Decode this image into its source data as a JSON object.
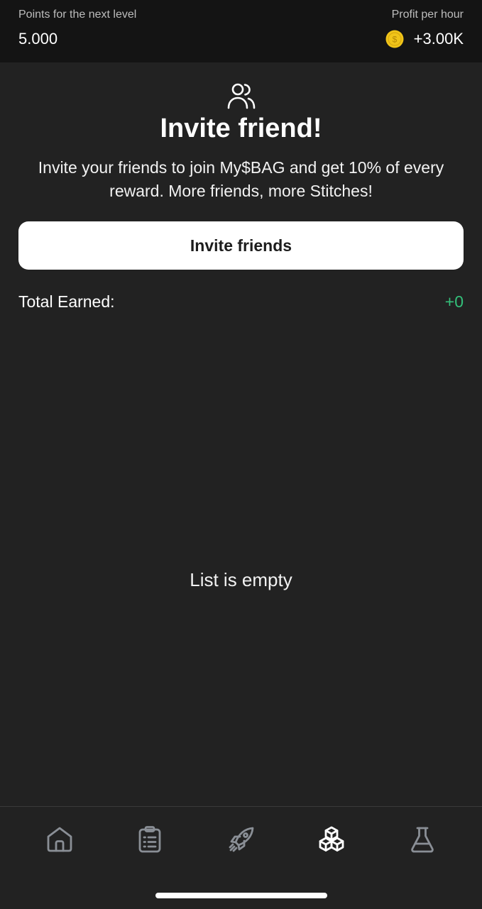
{
  "header": {
    "next_level_label": "Points for the next level",
    "next_level_value": "5.000",
    "profit_label": "Profit per hour",
    "profit_value": "+3.00K",
    "coin_color": "#f0c419"
  },
  "main": {
    "icon": "friends-icon",
    "title": "Invite friend!",
    "subtitle": "Invite your friends to join My$BAG and get 10% of every reward. More friends, more Stitches!",
    "invite_button_label": "Invite friends",
    "total_earned_label": "Total Earned:",
    "total_earned_value": "+0",
    "empty_text": "List is empty"
  },
  "nav": {
    "items": [
      {
        "icon": "home-icon",
        "active": false
      },
      {
        "icon": "clipboard-list-icon",
        "active": false
      },
      {
        "icon": "rocket-icon",
        "active": false
      },
      {
        "icon": "cubes-icon",
        "active": true
      },
      {
        "icon": "flask-icon",
        "active": false
      }
    ]
  },
  "colors": {
    "background": "#222222",
    "header_background": "#141414",
    "accent_green": "#33c07a",
    "nav_inactive": "#8a8f96",
    "nav_active": "#ffffff"
  }
}
